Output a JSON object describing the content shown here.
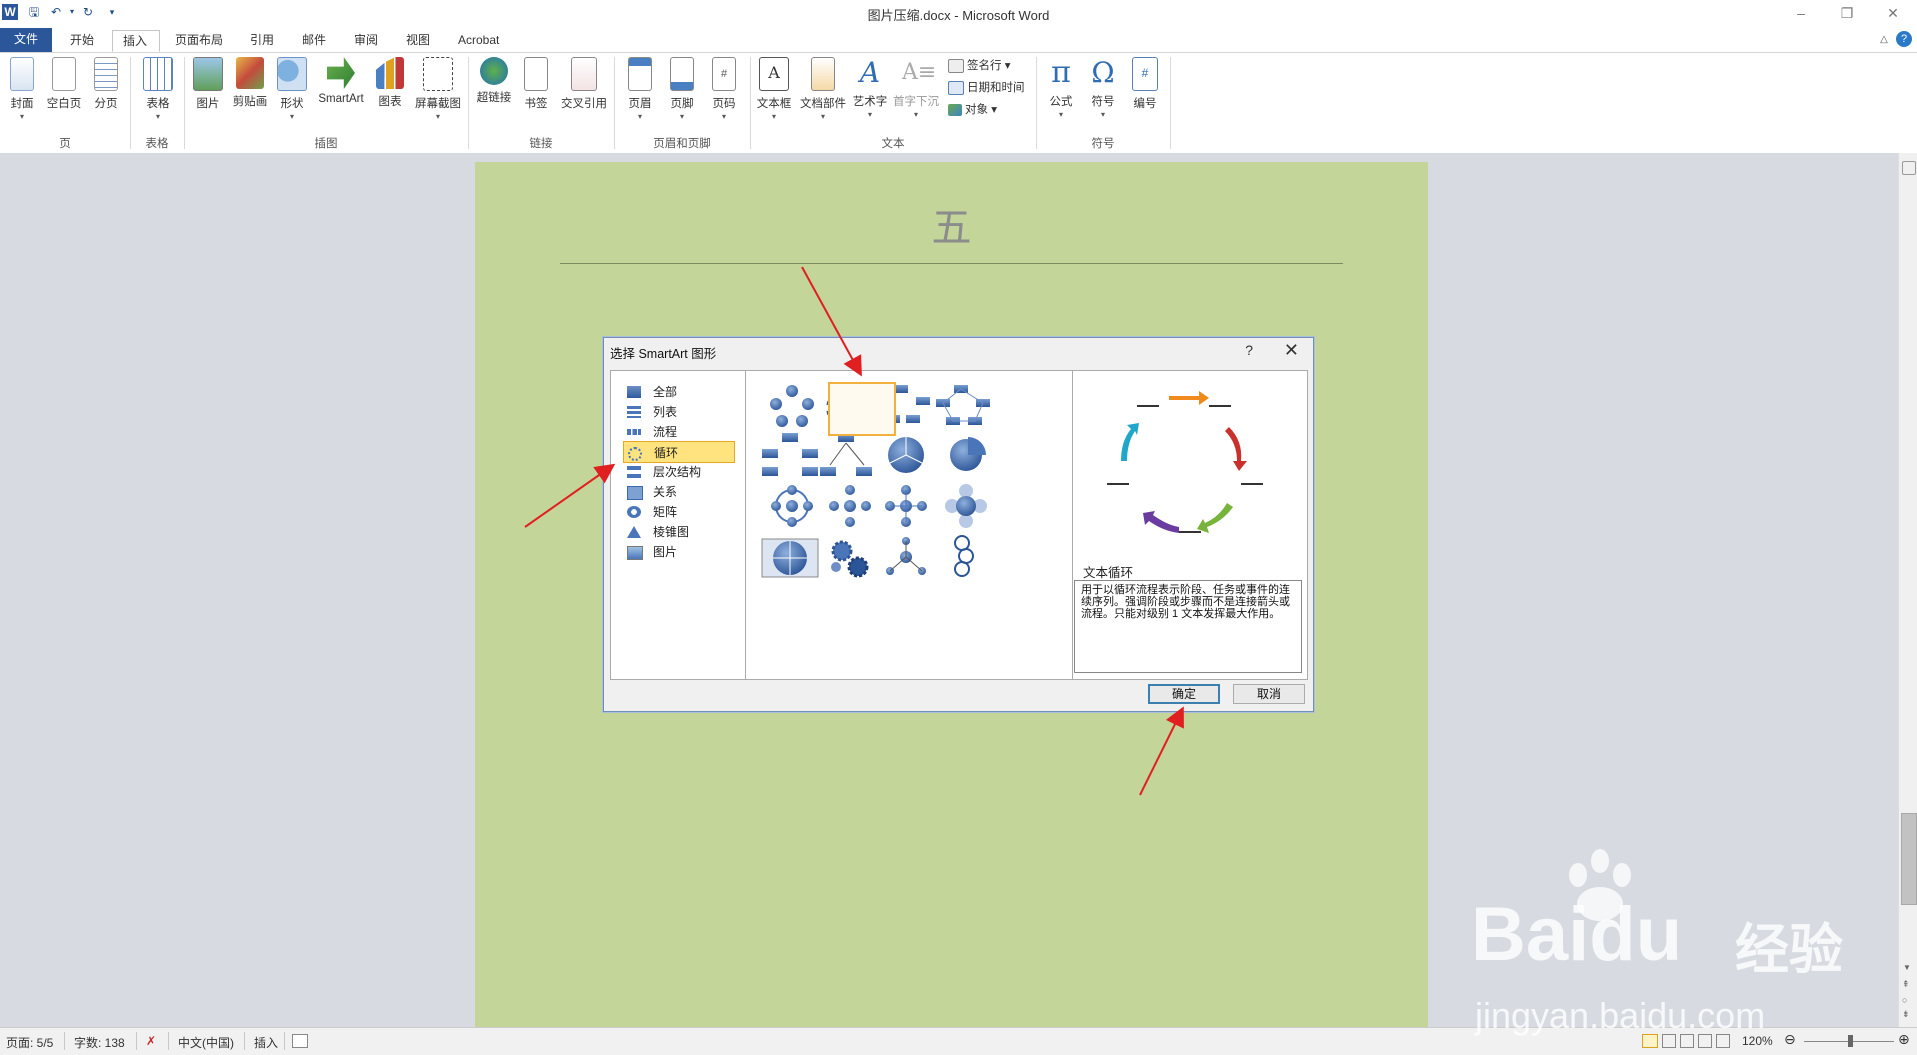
{
  "window": {
    "title": "图片压缩.docx - Microsoft Word",
    "app_icon": "W"
  },
  "tabs": [
    "文件",
    "开始",
    "插入",
    "页面布局",
    "引用",
    "邮件",
    "审阅",
    "视图",
    "Acrobat"
  ],
  "active_tab": "插入",
  "ribbon": {
    "buttons": {
      "cover": "封面",
      "blank": "空白页",
      "break": "分页",
      "table": "表格",
      "picture": "图片",
      "clipart": "剪贴画",
      "shapes": "形状",
      "smartart": "SmartArt",
      "chart": "图表",
      "screenshot": "屏幕截图",
      "hyperlink": "超链接",
      "bookmark": "书签",
      "crossref": "交叉引用",
      "header": "页眉",
      "footer": "页脚",
      "pagenum": "页码",
      "textbox": "文本框",
      "quickparts": "文档部件",
      "wordart": "艺术字",
      "dropcap": "首字下沉",
      "signature": "签名行",
      "datetime": "日期和时间",
      "object": "对象",
      "equation": "公式",
      "symbol": "符号",
      "number": "编号"
    },
    "groups": {
      "pages": "页",
      "tables": "表格",
      "illustrations": "插图",
      "links": "链接",
      "headerfooter": "页眉和页脚",
      "text": "文本",
      "symbols": "符号"
    }
  },
  "document": {
    "heading": "五"
  },
  "dialog": {
    "title": "选择 SmartArt 图形",
    "help": "?",
    "close": "✕",
    "categories": [
      "全部",
      "列表",
      "流程",
      "循环",
      "层次结构",
      "关系",
      "矩阵",
      "棱锥图",
      "图片"
    ],
    "selected_category": "循环",
    "preview_name": "文本循环",
    "preview_desc": "用于以循环流程表示阶段、任务或事件的连续序列。强调阶段或步骤而不是连接箭头或流程。只能对级别 1 文本发挥最大作用。",
    "ok": "确定",
    "cancel": "取消"
  },
  "status": {
    "page": "页面: 5/5",
    "words": "字数: 138",
    "language": "中文(中国)",
    "mode": "插入",
    "zoom": "120%"
  },
  "watermark": {
    "brand": "Baidu",
    "cn": "经验",
    "url": "jingyan.baidu.com"
  },
  "colors": {
    "file_tab": "#2b579a",
    "page_bg": "#c4d59a",
    "selection": "#ffe37f",
    "arrow": "#e02020"
  }
}
